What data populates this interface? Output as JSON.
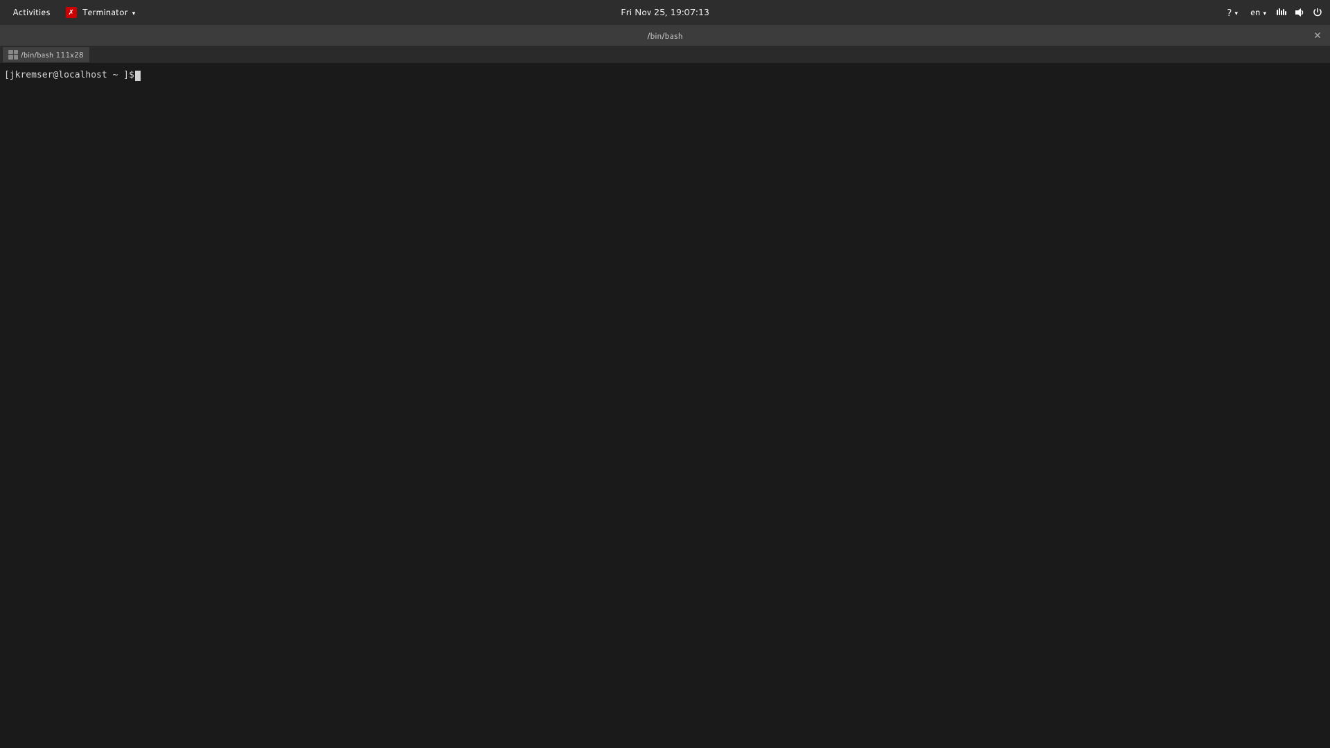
{
  "system_bar": {
    "activities_label": "Activities",
    "app_menu_label": "Terminator",
    "datetime": "Fri Nov 25, 19:07:13",
    "language": "en",
    "chevron": "▾"
  },
  "window": {
    "title": "/bin/bash",
    "tab_label": "/bin/bash 111x28",
    "close_symbol": "✕"
  },
  "terminal": {
    "prompt": "[jkremser@localhost ~ ]$ "
  },
  "icons": {
    "help": "?",
    "network": "⇌",
    "volume": "🔊",
    "power": "⏻"
  }
}
